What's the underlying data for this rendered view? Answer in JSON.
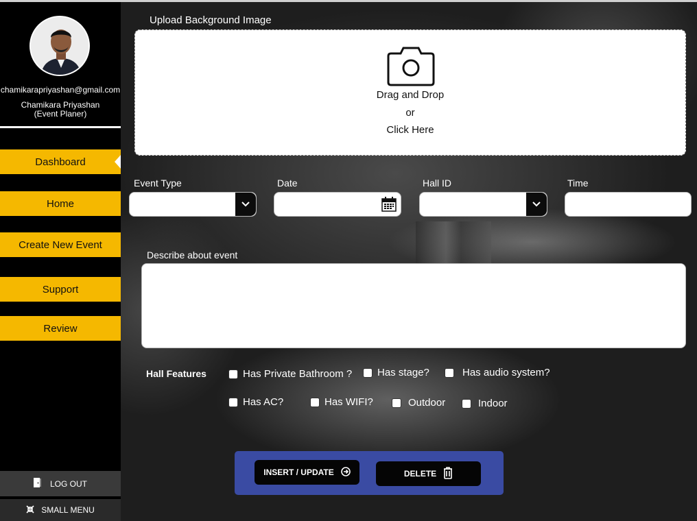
{
  "user": {
    "email": "chamikarapriyashan@gmail.com",
    "name": "Chamikara Priyashan",
    "role": "(Event Planer)"
  },
  "nav": {
    "items": [
      {
        "label": "Dashboard",
        "active": true
      },
      {
        "label": "Home"
      },
      {
        "label": "Create New Event"
      },
      {
        "label": "Support"
      },
      {
        "label": "Review"
      }
    ],
    "logout_label": "LOG OUT",
    "small_menu_label": "SMALL MENU"
  },
  "upload": {
    "title": "Upload Background Image",
    "line1": "Drag and Drop",
    "line2": "or",
    "line3": "Click Here",
    "icon": "camera-icon"
  },
  "form": {
    "event_type_label": "Event Type",
    "date_label": "Date",
    "hall_id_label": "Hall ID",
    "time_label": "Time",
    "event_type_value": "",
    "date_value": "",
    "hall_id_value": "",
    "time_value": "",
    "describe_label": "Describe about event",
    "describe_value": ""
  },
  "features": {
    "title": "Hall Features",
    "items": [
      {
        "label": "Has Private Bathroom ?",
        "checked": false
      },
      {
        "label": "Has stage?",
        "checked": false
      },
      {
        "label": "Has audio system?",
        "checked": false
      },
      {
        "label": "Has AC?",
        "checked": false
      },
      {
        "label": "Has WIFI?",
        "checked": false
      },
      {
        "label": "Outdoor",
        "checked": false
      },
      {
        "label": "Indoor",
        "checked": false
      }
    ]
  },
  "actions": {
    "insert_label": "INSERT / UPDATE",
    "delete_label": "DELETE"
  },
  "colors": {
    "accent": "#f5b800",
    "button_panel": "#3a4ba3",
    "sidebar": "#000000"
  }
}
